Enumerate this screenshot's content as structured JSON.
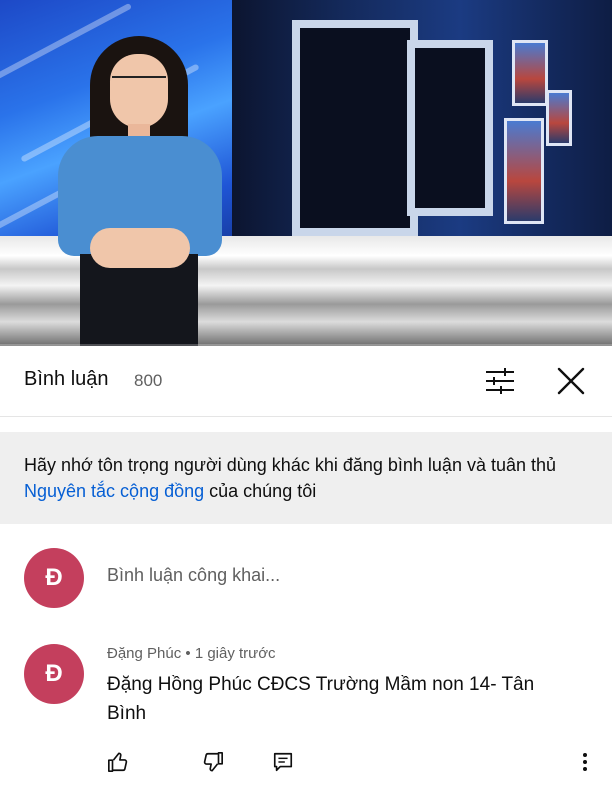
{
  "video": {
    "progress_fraction": 0.0
  },
  "comments_panel": {
    "title": "Bình luận",
    "count": "800",
    "filter_icon": "sliders-icon",
    "close_icon": "close-icon"
  },
  "notice": {
    "text_before": "Hãy nhớ tôn trọng người dùng khác khi đăng bình luận và tuân thủ ",
    "link_text": "Nguyên tắc cộng đồng",
    "text_after": " của chúng tôi"
  },
  "composer": {
    "avatar_letter": "Đ",
    "placeholder": "Bình luận công khai..."
  },
  "comment": {
    "avatar_letter": "Đ",
    "author": "Đặng Phúc",
    "separator": " • ",
    "time": "1 giây trước",
    "text": "Đặng Hồng Phúc CĐCS Trường Mầm non 14- Tân Bình",
    "actions": {
      "like_icon": "thumbs-up-icon",
      "dislike_icon": "thumbs-down-icon",
      "reply_icon": "reply-icon",
      "more_icon": "more-vertical-icon"
    }
  },
  "colors": {
    "avatar_bg": "#c43f5d",
    "link": "#065fd4",
    "notice_bg": "#efefef"
  }
}
